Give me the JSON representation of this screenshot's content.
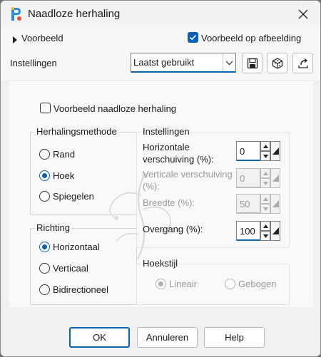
{
  "window": {
    "title": "Naadloze herhaling",
    "close_icon": "close-icon",
    "app_icon": "paintshop-app-icon"
  },
  "topbar": {
    "preview_toggle_label": "Voorbeeld",
    "preview_on_image_label": "Voorbeeld op afbeelding",
    "preview_on_image_checked": true,
    "settings_label": "Instellingen",
    "preset_value": "Laatst gebruikt",
    "preset_options_icon": "chevron-down-icon",
    "save_icon": "save-icon",
    "reset_icon": "cube-icon",
    "revert_icon": "revert-icon"
  },
  "main": {
    "seamless_preview_label": "Voorbeeld naadloze herhaling",
    "seamless_preview_checked": false,
    "method": {
      "title": "Herhalingsmethode",
      "options": [
        {
          "label": "Rand",
          "selected": false
        },
        {
          "label": "Hoek",
          "selected": true
        },
        {
          "label": "Spiegelen",
          "selected": false
        }
      ]
    },
    "direction": {
      "title": "Richting",
      "options": [
        {
          "label": "Horizontaal",
          "selected": true
        },
        {
          "label": "Verticaal",
          "selected": false
        },
        {
          "label": "Bidirectioneel",
          "selected": false
        }
      ]
    },
    "settings": {
      "title": "Instellingen",
      "horizontal_offset_line1": "Horizontale",
      "horizontal_offset_line2": "verschuiving (%):",
      "horizontal_offset_value": "0",
      "vertical_offset_line1": "Verticale verschuiving",
      "vertical_offset_line2": "(%):",
      "vertical_offset_value": "0",
      "width_label": "Breedte (%):",
      "width_value": "50",
      "transition_label": "Overgang (%):",
      "transition_value": "100"
    },
    "corner_style": {
      "title": "Hoekstijl",
      "options": [
        {
          "label": "Lineair",
          "selected": true
        },
        {
          "label": "Gebogen",
          "selected": false
        }
      ]
    }
  },
  "footer": {
    "ok_label": "OK",
    "cancel_label": "Annuleren",
    "help_label": "Help"
  },
  "colors": {
    "accent": "#0a64b4",
    "window_bg": "#f0f0f0",
    "disabled_text": "#9a9a9a"
  }
}
